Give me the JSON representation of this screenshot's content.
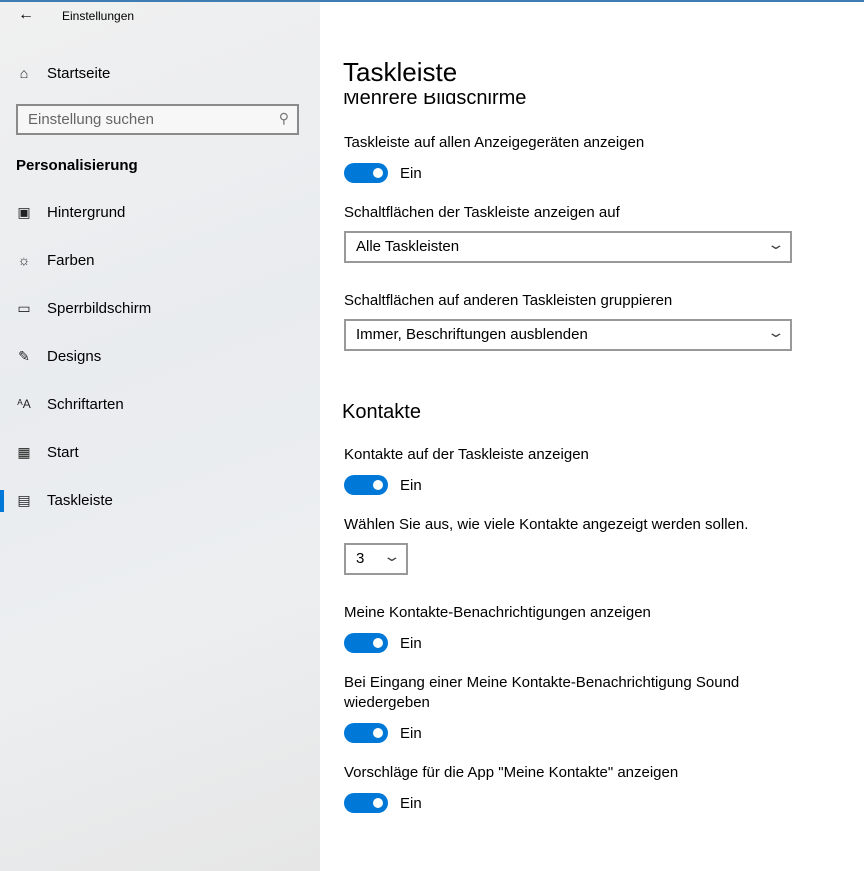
{
  "window": {
    "title": "Einstellungen"
  },
  "sidebar": {
    "home": "Startseite",
    "search_placeholder": "Einstellung suchen",
    "section": "Personalisierung",
    "items": [
      {
        "label": "Hintergrund",
        "icon": "image-icon"
      },
      {
        "label": "Farben",
        "icon": "palette-icon"
      },
      {
        "label": "Sperrbildschirm",
        "icon": "lock-screen-icon"
      },
      {
        "label": "Designs",
        "icon": "themes-icon"
      },
      {
        "label": "Schriftarten",
        "icon": "fonts-icon"
      },
      {
        "label": "Start",
        "icon": "start-icon"
      },
      {
        "label": "Taskleiste",
        "icon": "taskbar-icon",
        "active": true
      }
    ]
  },
  "main": {
    "title": "Taskleiste",
    "section1": "Mehrere Bildschirme",
    "show_all": {
      "label": "Taskleiste auf allen Anzeigegeräten anzeigen",
      "state": "Ein"
    },
    "buttons_on": {
      "label": "Schaltflächen der Taskleiste anzeigen auf",
      "value": "Alle Taskleisten"
    },
    "group": {
      "label": "Schaltflächen auf anderen Taskleisten gruppieren",
      "value": "Immer, Beschriftungen ausblenden"
    },
    "section2": "Kontakte",
    "contacts_show": {
      "label": "Kontakte auf der Taskleiste anzeigen",
      "state": "Ein"
    },
    "contacts_count": {
      "label": "Wählen Sie aus, wie viele Kontakte angezeigt werden sollen.",
      "value": "3"
    },
    "notif": {
      "label": "Meine Kontakte-Benachrichtigungen anzeigen",
      "state": "Ein"
    },
    "sound": {
      "label": "Bei Eingang einer Meine Kontakte-Benachrichtigung Sound wiedergeben",
      "state": "Ein"
    },
    "suggest": {
      "label": "Vorschläge für die App \"Meine Kontakte\" anzeigen",
      "state": "Ein"
    }
  },
  "colors": {
    "accent": "#0078d7"
  }
}
